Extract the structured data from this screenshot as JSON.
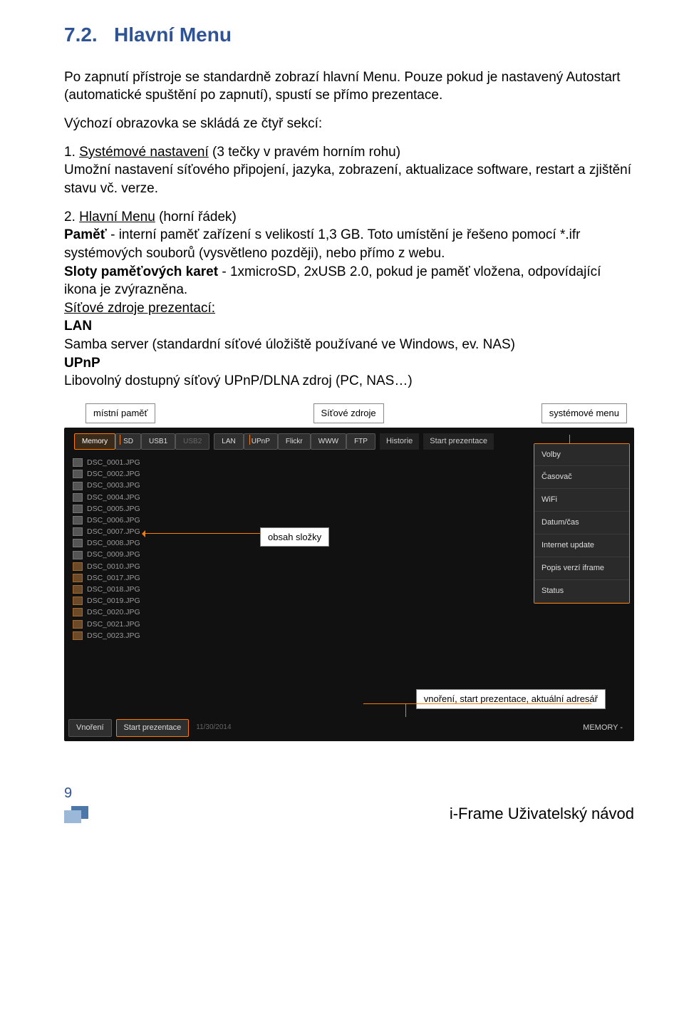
{
  "section": {
    "number": "7.2.",
    "title": "Hlavní Menu"
  },
  "p1": "Po zapnutí přístroje se standardně zobrazí hlavní Menu. Pouze pokud je nastavený Autostart (automatické spuštění po zapnutí), spustí se přímo prezentace.",
  "p2": "Výchozí obrazovka se skládá ze čtyř sekcí:",
  "item1_head_num": "1. ",
  "item1_head": "Systémové nastavení",
  "item1_tail": " (3 tečky v pravém horním rohu)",
  "item1_body": "Umožní nastavení síťového připojení, jazyka, zobrazení, aktualizace software, restart a zjištění stavu vč. verze.",
  "item2_head_num": "2. ",
  "item2_head": "Hlavní Menu",
  "item2_tail": " (horní řádek)",
  "item2_line1a": "Paměť",
  "item2_line1b": " - interní paměť zařízení s velikostí 1,3 GB. Toto umístění je řešeno pomocí *.ifr systémových souborů (vysvětleno později), nebo přímo z webu.",
  "item2_line2a": "Sloty paměťových karet",
  "item2_line2b": " - 1xmicroSD, 2xUSB 2.0, pokud je paměť vložena, odpovídající ikona je zvýrazněna.",
  "item2_line3": "Síťové zdroje prezentací:",
  "item2_lan": "LAN",
  "item2_lan_desc": "Samba server (standardní síťové úložiště používané ve Windows, ev. NAS)",
  "item2_upnp": "UPnP",
  "item2_upnp_desc": "Libovolný dostupný síťový UPnP/DLNA zdroj (PC, NAS…)",
  "callouts": {
    "local_mem": "místní paměť",
    "net_sources": "Síťové zdroje",
    "sys_menu": "systémové menu",
    "folder_contents": "obsah složky",
    "bottom": "vnoření, start prezentace, aktuální adresář"
  },
  "tabs": [
    "Memory",
    "SD",
    "USB1",
    "USB2",
    "LAN",
    "UPnP",
    "Flickr",
    "WWW",
    "FTP"
  ],
  "header_right": [
    "Historie",
    "Start prezentace"
  ],
  "right_menu": [
    "Volby",
    "Časovač",
    "WiFi",
    "Datum/čas",
    "Internet update",
    "Popis verzí iframe",
    "Status"
  ],
  "files": [
    "DSC_0001.JPG",
    "DSC_0002.JPG",
    "DSC_0003.JPG",
    "DSC_0004.JPG",
    "DSC_0005.JPG",
    "DSC_0006.JPG",
    "DSC_0007.JPG",
    "DSC_0008.JPG",
    "DSC_0009.JPG",
    "DSC_0010.JPG",
    "DSC_0017.JPG",
    "DSC_0018.JPG",
    "DSC_0019.JPG",
    "DSC_0020.JPG",
    "DSC_0021.JPG",
    "DSC_0023.JPG"
  ],
  "file_icon_alt_indices": [
    9,
    10,
    11,
    12,
    13,
    14,
    15
  ],
  "bottom_bar": {
    "nest": "Vnoření",
    "start": "Start prezentace",
    "date": "11/30/2014",
    "path": "MEMORY -"
  },
  "footer": {
    "page": "9",
    "title": "i-Frame Uživatelský návod"
  }
}
